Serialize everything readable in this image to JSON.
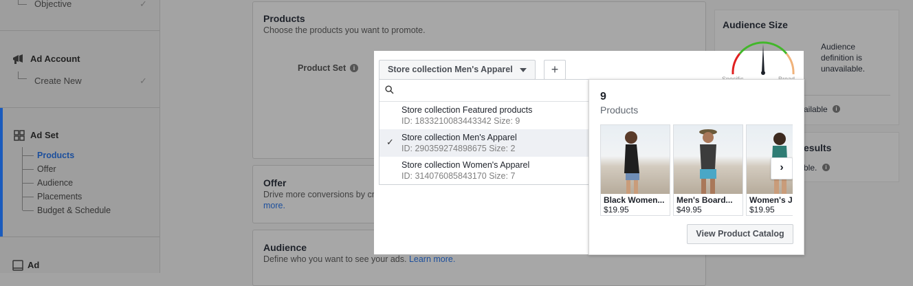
{
  "sidebar": {
    "objective_label": "Objective",
    "ad_account_title": "Ad Account",
    "ad_account_sub": "Create New",
    "ad_set_title": "Ad Set",
    "ad_set_items": [
      "Products",
      "Offer",
      "Audience",
      "Placements",
      "Budget & Schedule"
    ],
    "ad_title": "Ad"
  },
  "products_card": {
    "title": "Products",
    "description": "Choose the products you want to promote.",
    "field_label": "Product Set",
    "selected_set": "Store collection Men's Apparel",
    "add_label": "+"
  },
  "dropdown": {
    "search_placeholder": "",
    "items": [
      {
        "name": "Store collection Featured products",
        "meta": "ID: 1833210083443342 Size: 9"
      },
      {
        "name": "Store collection Men's Apparel",
        "meta": "ID: 290359274898675 Size: 2"
      },
      {
        "name": "Store collection Women's Apparel",
        "meta": "ID: 314076085843170 Size: 7"
      }
    ]
  },
  "offer_card": {
    "title": "Offer",
    "description": "Drive more conversions by creating an offer people can save and get reminders abou",
    "more_link": "more."
  },
  "audience_card": {
    "title": "Audience",
    "description": "Define who you want to see your ads.",
    "learn_more": "Learn more."
  },
  "popover": {
    "count": "9",
    "label": "Products",
    "products": [
      {
        "name": "Black Women...",
        "price": "$19.95"
      },
      {
        "name": "Men's Board...",
        "price": "$49.95"
      },
      {
        "name": "Women's J",
        "price": "$19.95"
      }
    ],
    "view_catalog": "View Product Catalog"
  },
  "right": {
    "audience_size_title": "Audience Size",
    "audience_text": "Audience definition is unavailable.",
    "gauge_left": "Specific",
    "gauge_right": "Broad",
    "available_text": "vailable",
    "results_title": "esults",
    "results_text": "ble."
  },
  "colors": {
    "accent": "#1c4f9c",
    "gauge_green": "#42b72a",
    "gauge_red": "#e02020",
    "gauge_orange": "#f0b27a"
  }
}
